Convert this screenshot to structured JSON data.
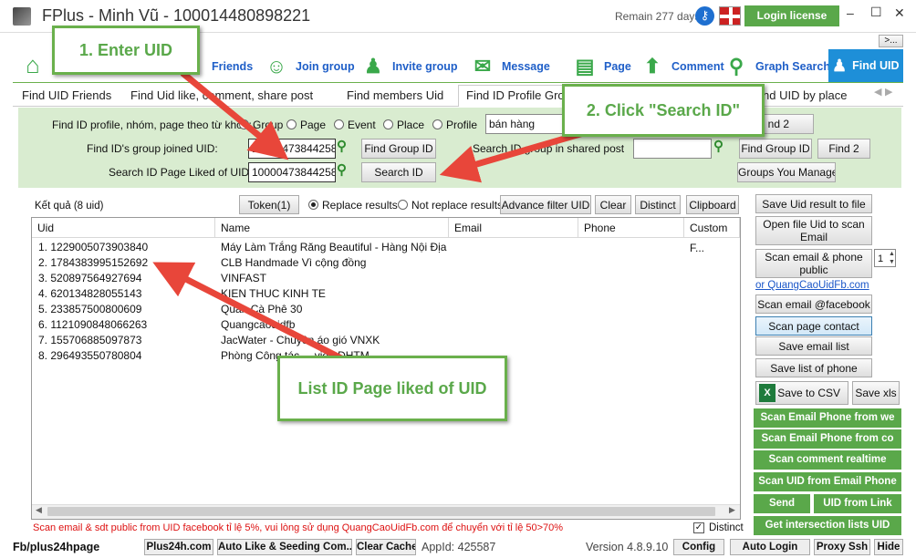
{
  "window": {
    "title": "FPlus - Minh Vũ - 100014480898221",
    "remain": "Remain 277 days",
    "login_label": "Login license",
    "minimize": "–",
    "maximize": "☐",
    "close": "✕",
    "expand": ">..."
  },
  "nav": {
    "friends": "Friends",
    "join_group": "Join group",
    "invite_group": "Invite group",
    "message": "Message",
    "page": "Page",
    "comment": "Comment",
    "graph_search": "Graph Search",
    "find_uid": "Find UID"
  },
  "tabs": [
    "Find UID Friends",
    "Find Uid like, comment, share post",
    "Find members Uid",
    "Find ID Profile Gro",
    "nd UID by place"
  ],
  "form": {
    "find_id_label": "Find ID profile, nhóm, page theo từ khóa:",
    "radio_group": "Group",
    "radio_page": "Page",
    "radio_event": "Event",
    "radio_place": "Place",
    "radio_profile": "Profile",
    "keyword": "bán hàng",
    "find2_top": "nd 2",
    "group_joined_label": "Find ID's group joined UID:",
    "group_uid": "100004738442580",
    "find_group_id": "Find Group ID",
    "shared_post_label": "Search ID group in shared post",
    "find_group_id2": "Find Group ID",
    "find2": "Find 2",
    "page_liked_label": "Search ID Page Liked of UID:",
    "page_uid": "100004738442580",
    "search_id": "Search ID",
    "groups_you_manage": "Groups You Manage"
  },
  "results": {
    "count": "Kết quả (8 uid)",
    "token": "Token(1)",
    "replace": "Replace results",
    "not_replace": "Not replace results",
    "advance_filter": "Advance filter UID",
    "clear": "Clear",
    "distinct": "Distinct",
    "clipboard": "Clipboard"
  },
  "table": {
    "columns": [
      "Uid",
      "Name",
      "Email",
      "Phone",
      "Custom F..."
    ],
    "rows": [
      {
        "uid": "1. 1229005073903840",
        "name": "Máy Làm Trắng Răng Beautiful - Hàng Nội Địa H..."
      },
      {
        "uid": "2. 1784383995152692",
        "name": "CLB Handmade Vì cộng đồng"
      },
      {
        "uid": "3. 520897564927694",
        "name": "VINFAST"
      },
      {
        "uid": "4. 620134828055143",
        "name": "KIEN THUC KINH TE"
      },
      {
        "uid": "5. 233857500800609",
        "name": "Quán Cà Phê 30"
      },
      {
        "uid": "6. 1121090848066263",
        "name": "Quangcaouidfb"
      },
      {
        "uid": "7. 155706885097873",
        "name": "JacWater - Chuyên áo gió VNXK"
      },
      {
        "uid": "8. 296493550780804",
        "name": "Phòng Công tác ... viên DHTM"
      }
    ]
  },
  "side": {
    "save_uid": "Save Uid result to file",
    "open_file": "Open file Uid to scan Email",
    "scan_email_phone": "Scan email & phone public",
    "spin_value": "1",
    "link": "or QuangCaoUidFb.com",
    "scan_email_fb": "Scan email @facebook",
    "scan_page_contact": "Scan page contact",
    "save_email": "Save email list",
    "save_phone": "Save list of phone",
    "save_csv": "Save to CSV",
    "save_xls": "Save xls",
    "green": [
      "Scan Email Phone from we",
      "Scan Email Phone from co",
      "Scan comment realtime",
      "Scan UID from Email Phone"
    ],
    "send": "Send",
    "uid_from_link": "UID from Link",
    "intersection": "Get intersection lists UID"
  },
  "notice": "Scan email & sdt public from UID facebook tỉ lệ 5%, vui lòng sử dụng QuangCaoUidFb.com để chuyển với tỉ lệ 50>70%",
  "distinct_check": "Distinct",
  "statusbar": {
    "fb": "Fb/plus24hpage",
    "plus24h": "Plus24h.com",
    "auto_like": "Auto Like & Seeding Com...",
    "clear_cache": "Clear Cache",
    "appid": "AppId: 425587",
    "version": "Version 4.8.9.10",
    "config": "Config",
    "auto_login": "Auto Login",
    "proxy_ssh": "Proxy Ssh",
    "hide": "Hide"
  },
  "callouts": {
    "enter_uid": "1. Enter UID",
    "click_search": "2. Click \"Search ID\"",
    "list_id": "List ID Page liked of UID"
  },
  "colors": {
    "accent": "#5aa84a",
    "nav_blue": "#1f5fc8",
    "find_uid_tab": "#1e8fd8",
    "arrow": "#e8463a"
  }
}
